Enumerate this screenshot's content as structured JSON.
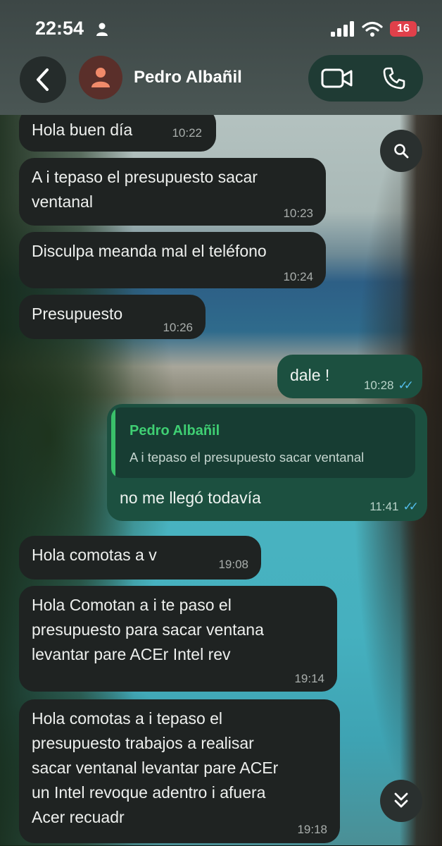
{
  "status_bar": {
    "time": "22:54",
    "battery": "16"
  },
  "header": {
    "contact_name": "Pedro Albañil"
  },
  "messages": [
    {
      "direction": "in",
      "text": "Hola buen día",
      "time": "10:22"
    },
    {
      "direction": "in",
      "text": "A i tepaso el presupuesto  sacar\nventanal",
      "time": "10:23"
    },
    {
      "direction": "in",
      "text": "Disculpa meanda mal el teléfono",
      "time": "10:24"
    },
    {
      "direction": "in",
      "text": "Presupuesto",
      "time": "10:26"
    },
    {
      "direction": "out",
      "text": "dale !",
      "time": "10:28"
    },
    {
      "direction": "out",
      "text": "no me llegó todavía",
      "time": "11:41",
      "quote": {
        "author": "Pedro Albañil",
        "text": "A i tepaso el presupuesto  sacar ventanal"
      }
    },
    {
      "direction": "in",
      "text": "Hola  comotas   a v",
      "time": "19:08"
    },
    {
      "direction": "in",
      "text": "Hola Comotan   a i te paso el\npresupuesto  para sacar ventana\nlevantar pare  ACEr Intel  rev",
      "time": "19:14"
    },
    {
      "direction": "in",
      "text": "Hola comotas  a i tepaso  el\npresupuesto trabajos a realisar\nsacar ventanal levantar pare ACEr\nun Intel  revoque adentro i afuera\nAcer recuadr",
      "time": "19:18"
    }
  ],
  "icons": {
    "back": "chevron-left-icon",
    "avatar": "person-icon",
    "video": "video-camera-icon",
    "phone": "phone-icon",
    "search": "search-icon",
    "scroll_down": "double-chevron-down-icon",
    "read_receipt": "double-check-icon"
  },
  "colors": {
    "incoming_bubble": "#1f2322",
    "outgoing_bubble": "#1c5040",
    "quote_accent": "#3ac06a",
    "read_tick": "#53bdeb",
    "battery_low": "#e0404a"
  }
}
